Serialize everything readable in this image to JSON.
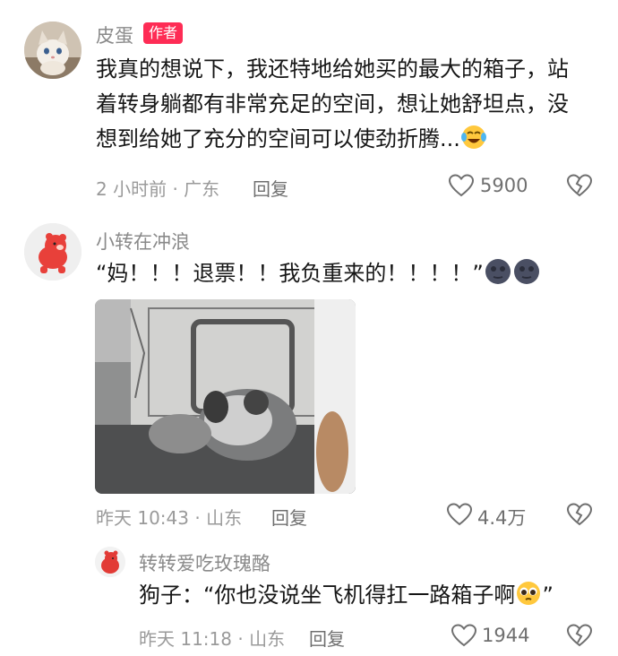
{
  "comments": [
    {
      "author": "皮蛋",
      "badge": "作者",
      "text": "我真的想说下，我还特地给她买的最大的箱子，站着转身躺都有非常充足的空间，想让她舒坦点，没想到给她了充分的空间可以使劲折腾...",
      "time_location": "2 小时前 · 广东",
      "reply_label": "回复",
      "likes": "5900"
    },
    {
      "author": "小转在冲浪",
      "text": "“妈！！！退票！！我负重来的！！！！”",
      "time_location": "昨天 10:43 · 山东",
      "reply_label": "回复",
      "likes": "4.4万"
    },
    {
      "author": "转转爱吃玫瑰酪",
      "text": "狗子：“你也没说坐飞机得扛一路箱子啊",
      "text_tail": "”",
      "time_location": "昨天 11:18 · 山东",
      "reply_label": "回复",
      "likes": "1944"
    }
  ],
  "icons": {
    "like": "heart-outline-icon",
    "dislike": "broken-heart-icon",
    "emoji_laugh": "laughing-tears-emoji",
    "emoji_moon": "new-moon-face-emoji",
    "emoji_plead": "pleading-face-emoji"
  },
  "colors": {
    "badge": "#fe2c55",
    "meta": "#9a9a9a",
    "name": "#8a8a8a"
  }
}
